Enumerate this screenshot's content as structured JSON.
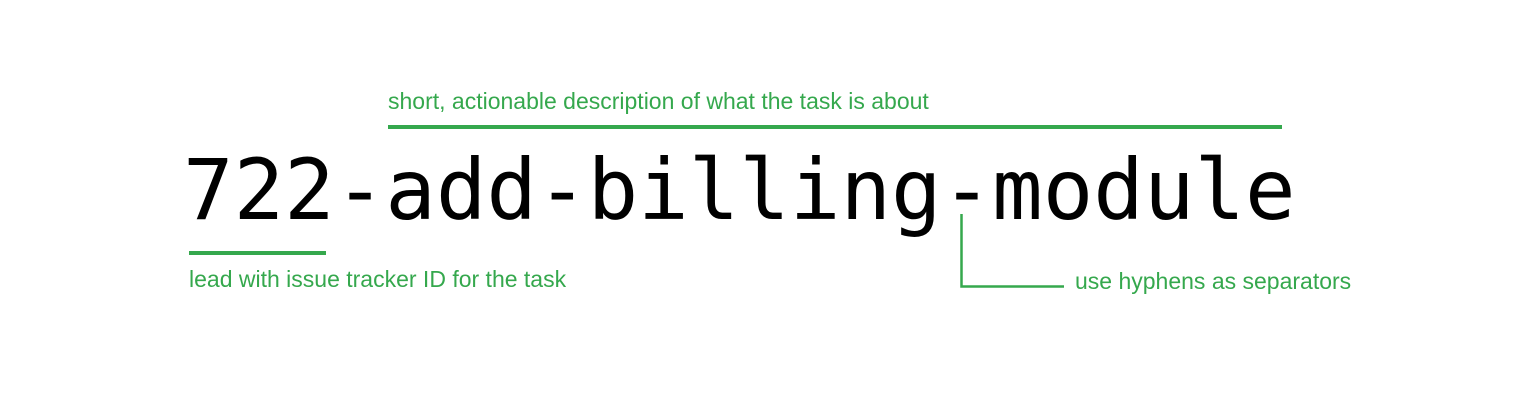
{
  "diagram": {
    "example_branch_name": "722-add-billing-module",
    "annotations": {
      "description": "short, actionable description of what the task is about",
      "issue_id": "lead with issue tracker ID for the task",
      "separators": "use hyphens as separators"
    },
    "colors": {
      "annotation": "#35a84d",
      "text": "#000000",
      "background": "#ffffff"
    }
  }
}
